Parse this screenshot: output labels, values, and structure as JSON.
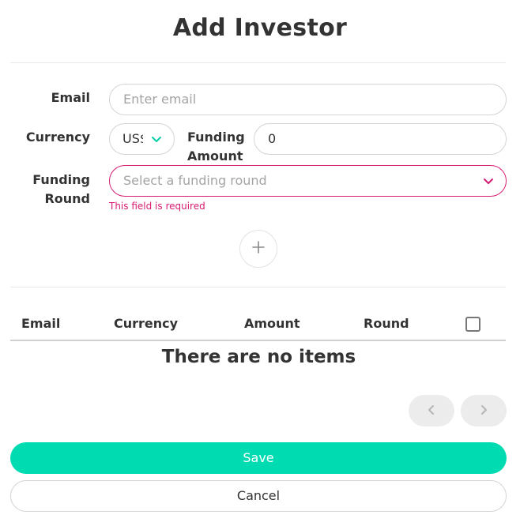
{
  "modal": {
    "title": "Add Investor"
  },
  "form": {
    "email_label": "Email",
    "email_placeholder": "Enter email",
    "currency_label": "Currency",
    "currency_value": "US$",
    "funding_amount_label_line1": "Funding",
    "funding_amount_label_line2": "Amount",
    "funding_amount_value": "0",
    "funding_round_label_line1": "Funding",
    "funding_round_label_line2": "Round",
    "funding_round_placeholder": "Select a funding round",
    "funding_round_error": "This field is required"
  },
  "table": {
    "columns": [
      "Email",
      "Currency",
      "Amount",
      "Round"
    ],
    "empty_message": "There are no items"
  },
  "actions": {
    "save_label": "Save",
    "cancel_label": "Cancel"
  },
  "icons": {
    "currency_chevron": "chevron-down-icon",
    "round_chevron": "chevron-down-icon",
    "add": "plus-icon",
    "prev": "chevron-left-icon",
    "next": "chevron-right-icon"
  },
  "colors": {
    "accent": "#00dbb1",
    "error": "#d81b72",
    "text": "#333333",
    "placeholder": "#a4a4a4"
  }
}
